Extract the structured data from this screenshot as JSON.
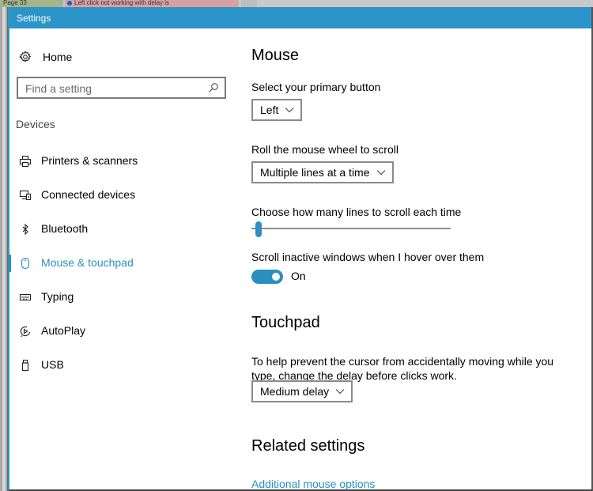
{
  "background": {
    "tab1_text": "Page 33",
    "tab2_text": "Left click not working with delay is"
  },
  "window": {
    "title": "Settings",
    "accent_color": "#2b94c9"
  },
  "sidebar": {
    "home_label": "Home",
    "search_placeholder": "Find a setting",
    "section_label": "Devices",
    "items": [
      {
        "label": "Printers & scanners",
        "icon": "printer-icon",
        "active": false
      },
      {
        "label": "Connected devices",
        "icon": "connected-devices-icon",
        "active": false
      },
      {
        "label": "Bluetooth",
        "icon": "bluetooth-icon",
        "active": false
      },
      {
        "label": "Mouse & touchpad",
        "icon": "mouse-icon",
        "active": true
      },
      {
        "label": "Typing",
        "icon": "keyboard-icon",
        "active": false
      },
      {
        "label": "AutoPlay",
        "icon": "autoplay-icon",
        "active": false
      },
      {
        "label": "USB",
        "icon": "usb-icon",
        "active": false
      }
    ]
  },
  "main": {
    "mouse": {
      "heading": "Mouse",
      "primary_button_label": "Select your primary button",
      "primary_button_value": "Left",
      "wheel_label": "Roll the mouse wheel to scroll",
      "wheel_value": "Multiple lines at a time",
      "lines_label": "Choose how many lines to scroll each time",
      "lines_slider_fraction": 0.02,
      "inactive_label": "Scroll inactive windows when I hover over them",
      "inactive_toggle_state": "On",
      "inactive_toggle_on": true
    },
    "touchpad": {
      "heading": "Touchpad",
      "description": "To help prevent the cursor from accidentally moving while you type, change the delay before clicks work.",
      "delay_value": "Medium delay"
    },
    "related": {
      "heading": "Related settings",
      "link_label": "Additional mouse options"
    }
  }
}
